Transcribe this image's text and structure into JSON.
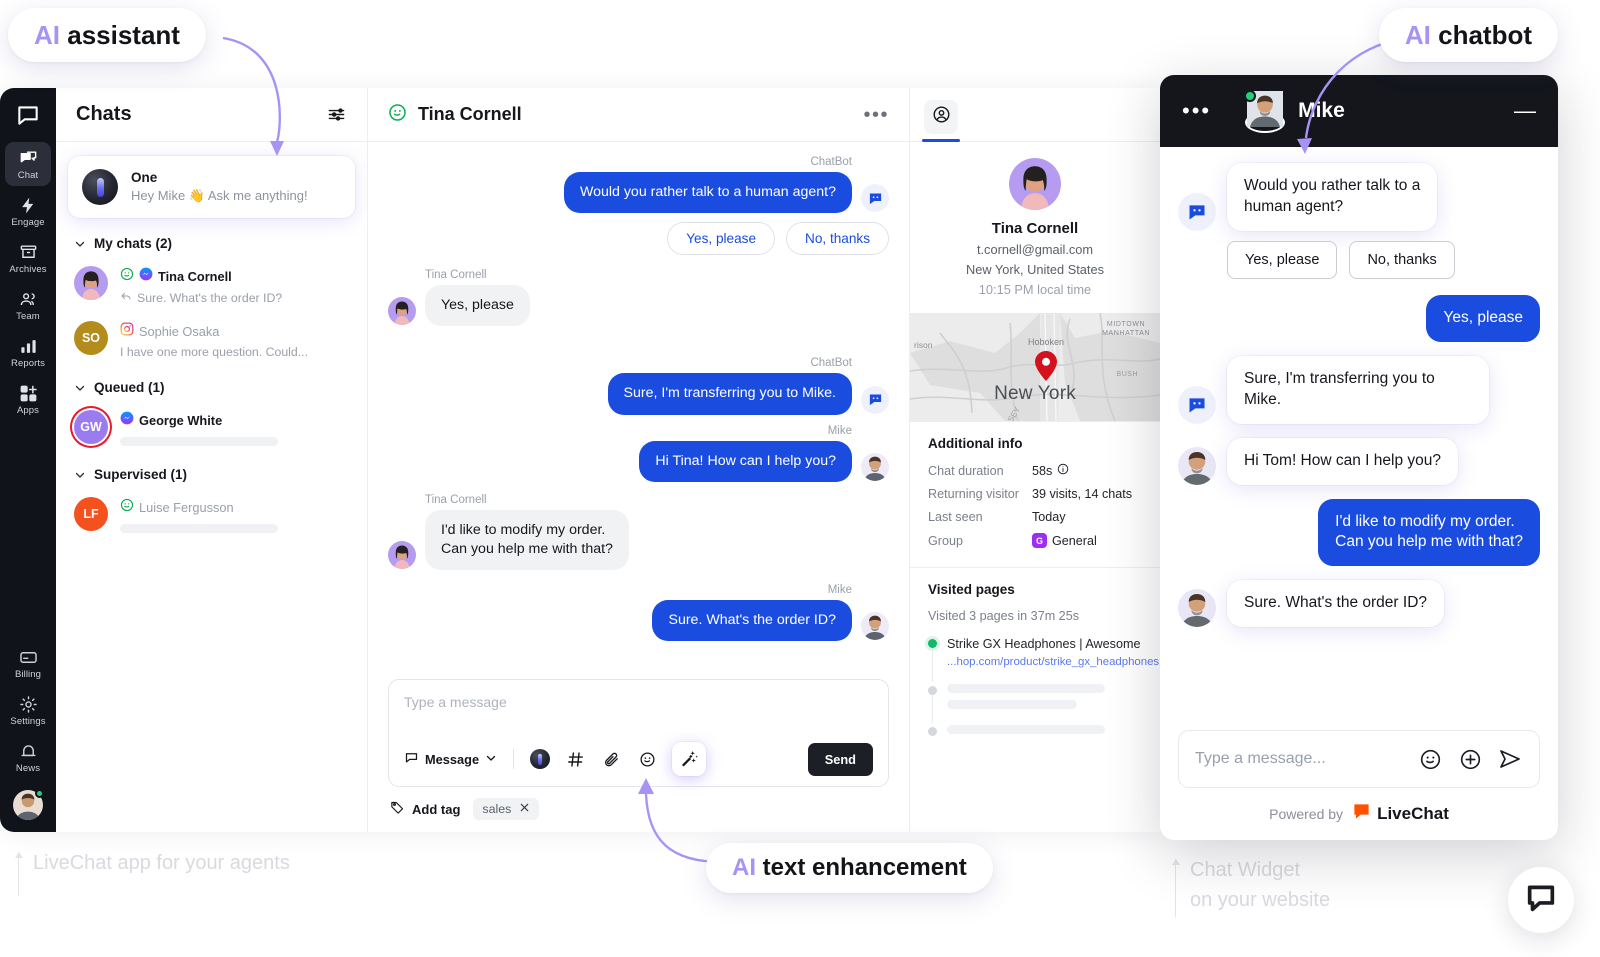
{
  "callouts": {
    "ai_assistant": {
      "prefix": "AI",
      "label": "assistant"
    },
    "ai_chatbot": {
      "prefix": "AI",
      "label": "chatbot"
    },
    "ai_text_enhancement": {
      "prefix": "AI",
      "label": "text enhancement"
    }
  },
  "captions": {
    "left": "LiveChat app for your agents",
    "right": "Chat Widget\non your website"
  },
  "rail": {
    "logo_icon": "livechat-logo-icon",
    "items": [
      {
        "label": "Chat",
        "icon": "chat-icon",
        "active": true
      },
      {
        "label": "Engage",
        "icon": "lightning-icon",
        "active": false
      },
      {
        "label": "Archives",
        "icon": "archive-icon",
        "active": false
      },
      {
        "label": "Team",
        "icon": "team-icon",
        "active": false
      },
      {
        "label": "Reports",
        "icon": "reports-icon",
        "active": false
      },
      {
        "label": "Apps",
        "icon": "apps-icon",
        "active": false
      }
    ],
    "bottom_items": [
      {
        "label": "Billing",
        "icon": "billing-icon"
      },
      {
        "label": "Settings",
        "icon": "gear-icon"
      },
      {
        "label": "News",
        "icon": "bell-icon"
      }
    ],
    "avatar_status": "online"
  },
  "chats": {
    "title": "Chats",
    "filter_icon": "filter-sliders-icon",
    "assistant": {
      "name": "One",
      "preview": "Hey Mike  👋 Ask me anything!"
    },
    "sections": [
      {
        "title": "My chats (2)",
        "items": [
          {
            "name": "Tina Cornell",
            "preview": "Sure. What's the order ID?",
            "initials": "",
            "channel": "messenger",
            "rating": "happy",
            "muted": false,
            "reply_icon": "reply-arrow-icon",
            "placeholder_bar": false,
            "avatar_color": "#b59cf0"
          },
          {
            "name": "Sophie Osaka",
            "preview": "I have one more question. Could...",
            "initials": "SO",
            "channel": "instagram",
            "rating": "",
            "muted": true,
            "reply_icon": "",
            "placeholder_bar": false,
            "avatar_color": "#b38c1c"
          }
        ]
      },
      {
        "title": "Queued (1)",
        "items": [
          {
            "name": "George White",
            "preview": "",
            "initials": "GW",
            "channel": "messenger",
            "rating": "",
            "muted": false,
            "reply_icon": "",
            "placeholder_bar": true,
            "avatar_color": "#9b7bf0",
            "ring": true
          }
        ]
      },
      {
        "title": "Supervised (1)",
        "items": [
          {
            "name": "Luise  Fergusson",
            "preview": "",
            "initials": "LF",
            "channel": "",
            "rating": "happy",
            "muted": true,
            "reply_icon": "",
            "placeholder_bar": true,
            "avatar_color": "#f4511e"
          }
        ]
      }
    ]
  },
  "conversation": {
    "title": "Tina Cornell",
    "rating_icon": "happy-face-icon",
    "more_icon": "more-dots-icon",
    "messages": [
      {
        "author": "ChatBot",
        "text": "Would you rather talk to a human agent?",
        "side": "out",
        "avatar": "bot"
      },
      {
        "author": "Tina Cornell",
        "text": "Yes, please",
        "side": "in",
        "avatar": "tina"
      },
      {
        "author": "ChatBot",
        "text": "Sure, I'm transferring you to Mike.",
        "side": "out",
        "avatar": "bot"
      },
      {
        "author": "Mike",
        "text": "Hi Tina! How can I help you?",
        "side": "out",
        "avatar": "mike"
      },
      {
        "author": "Tina Cornell",
        "text": "I'd like to modify my order.\nCan you help me with that?",
        "side": "in",
        "avatar": "tina"
      },
      {
        "author": "Mike",
        "text": "Sure. What's the order ID?",
        "side": "out",
        "avatar": "mike"
      }
    ],
    "quick_replies": [
      "Yes, please",
      "No, thanks"
    ],
    "composer": {
      "placeholder": "Type a message",
      "message_type": "Message",
      "chevron_icon": "chevron-down-icon",
      "tools": [
        "one-ai-icon",
        "hash-icon",
        "attachment-icon",
        "emoji-icon",
        "magic-wand-icon"
      ],
      "send_label": "Send"
    },
    "tags": {
      "add_label": "Add tag",
      "tag_icon": "tag-icon",
      "chips": [
        "sales"
      ],
      "remove_icon": "close-icon"
    }
  },
  "details": {
    "tab_icon": "person-circle-icon",
    "name": "Tina Cornell",
    "email": "t.cornell@gmail.com",
    "location": "New York, United States",
    "local_time": "10:15 PM local time",
    "map": {
      "city": "New York",
      "labels": [
        "MIDTOWN MANHATTAN",
        "Hoboken",
        "rison",
        "BUSH",
        "SEY"
      ],
      "pin_icon": "map-pin-icon"
    },
    "additional_info": {
      "title": "Additional info",
      "rows": [
        {
          "key": "Chat duration",
          "value": "58s",
          "icon": "info-icon"
        },
        {
          "key": "Returning visitor",
          "value": "39 visits, 14 chats",
          "icon": ""
        },
        {
          "key": "Last seen",
          "value": "Today",
          "icon": ""
        },
        {
          "key": "Group",
          "value": "General",
          "icon": "",
          "badge": "G"
        }
      ]
    },
    "visited_pages": {
      "title": "Visited pages",
      "summary": "Visited 3 pages in 37m 25s",
      "items": [
        {
          "title": "Strike GX Headphones | Awesome",
          "url": "...hop.com/product/strike_gx_headphones",
          "active": true
        },
        {
          "title": "",
          "url": "",
          "active": false
        },
        {
          "title": "",
          "url": "",
          "active": false
        }
      ]
    }
  },
  "widget": {
    "menu_icon": "more-dots-icon",
    "agent_name": "Mike",
    "agent_status": "online",
    "minimize_icon": "minimize-icon",
    "messages": [
      {
        "from": "bot",
        "text": "Would you rather talk to a\nhuman agent?",
        "side": "in"
      },
      {
        "from": "bot",
        "text": "Sure, I'm transferring you to Mike.",
        "side": "in"
      },
      {
        "from": "agent",
        "text": "Hi Tom! How can I help you?",
        "side": "in"
      },
      {
        "from": "visitor",
        "text": "I'd like to modify my order.\nCan you help me with that?",
        "side": "out"
      },
      {
        "from": "agent",
        "text": "Sure. What's the order ID?",
        "side": "in"
      }
    ],
    "visitor_reply": "Yes, please",
    "quick_replies": [
      "Yes, please",
      "No, thanks"
    ],
    "composer": {
      "placeholder": "Type a message...",
      "icons": [
        "emoji-icon",
        "plus-circle-icon",
        "send-icon"
      ]
    },
    "powered_by": "Powered by",
    "brand": "LiveChat"
  },
  "fab": {
    "icon": "chat-bubble-icon"
  },
  "colors": {
    "accent_blue": "#1a4ce0",
    "dark": "#14161c",
    "ai_purple": "#a893f5",
    "online_green": "#21d07a",
    "brand_orange": "#ff5100"
  }
}
